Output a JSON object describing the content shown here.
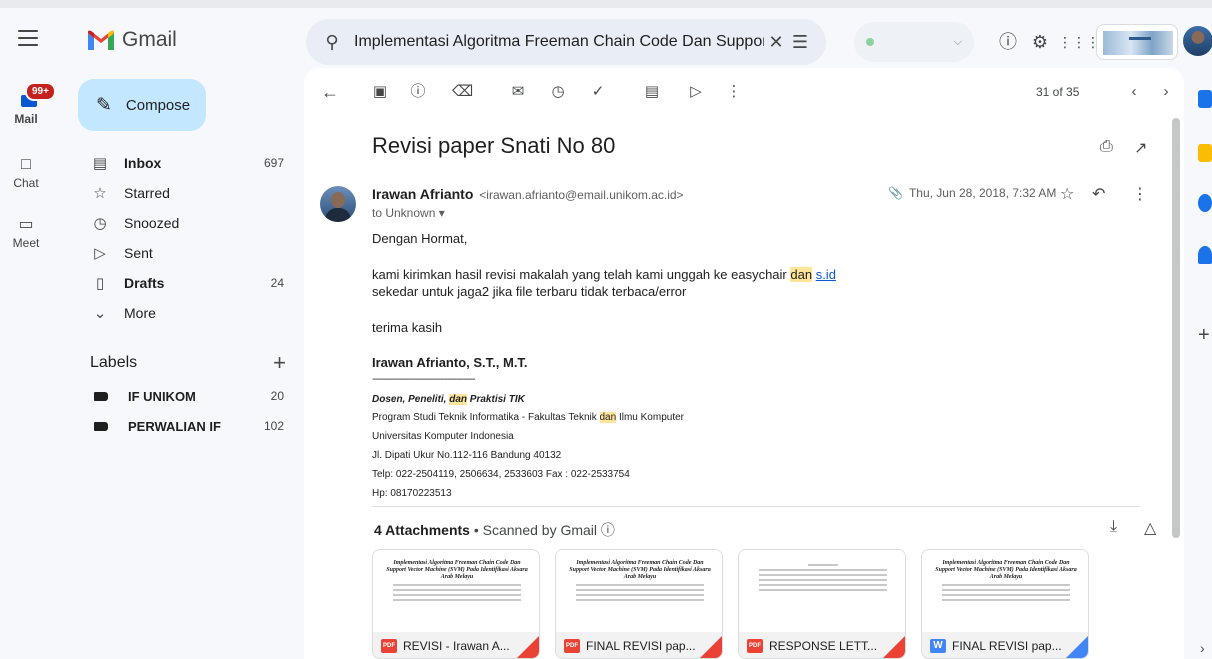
{
  "header": {
    "app_name": "Gmail",
    "search_value": "Implementasi Algoritma Freeman Chain Code Dan Support"
  },
  "rail": {
    "mail_badge": "99+",
    "items": [
      {
        "label": "Mail"
      },
      {
        "label": "Chat"
      },
      {
        "label": "Meet"
      }
    ]
  },
  "sidebar": {
    "compose_label": "Compose",
    "nav": [
      {
        "label": "Inbox",
        "count": "697",
        "icon": "inbox-icon",
        "bold": true
      },
      {
        "label": "Starred",
        "count": "",
        "icon": "star-icon",
        "bold": false
      },
      {
        "label": "Snoozed",
        "count": "",
        "icon": "clock-icon",
        "bold": false
      },
      {
        "label": "Sent",
        "count": "",
        "icon": "send-icon",
        "bold": false
      },
      {
        "label": "Drafts",
        "count": "24",
        "icon": "draft-icon",
        "bold": true
      },
      {
        "label": "More",
        "count": "",
        "icon": "chevron-down-icon",
        "bold": false
      }
    ],
    "labels_title": "Labels",
    "labels": [
      {
        "label": "IF UNIKOM",
        "count": "20"
      },
      {
        "label": "PERWALIAN IF",
        "count": "102"
      }
    ]
  },
  "toolbar": {
    "pager": "31 of 35"
  },
  "message": {
    "subject": "Revisi paper Snati No 80",
    "sender_name": "Irawan Afrianto",
    "sender_email": "<irawan.afrianto@email.unikom.ac.id>",
    "to": "to Unknown",
    "date": "Thu, Jun 28, 2018, 7:32 AM",
    "greeting": "Dengan Hormat,",
    "line1_pre": "kami kirimkan hasil revisi makalah yang telah kami unggah ke easychair ",
    "line1_hl": "dan",
    "line1_link": "s.id",
    "line2": "sekedar untuk jaga2 jika file terbaru tidak terbaca/error",
    "thanks": "terima kasih",
    "sig_name": "Irawan Afrianto, S.T., M.T.",
    "sig_rule": "--------------------------------------------",
    "sig_role_pre": "Dosen, Peneliti, ",
    "sig_role_hl": "dan",
    "sig_role_post": " Praktisi TIK",
    "sig_prog_pre": "Program Studi Teknik Informatika - Fakultas Teknik ",
    "sig_prog_hl": "dan",
    "sig_prog_post": " Ilmu Komputer",
    "sig_univ": "Universitas Komputer Indonesia",
    "sig_addr": "Jl. Dipati Ukur No.112-116 Bandung 40132",
    "sig_telp": "Telp: 022-2504119, 2506634, 2533603 Fax : 022-2533754",
    "sig_hp": "Hp: 08170223513"
  },
  "attachments": {
    "count_label": "4 Attachments",
    "scanned": " •  Scanned by Gmail",
    "items": [
      {
        "name": "REVISI - Irawan A...",
        "type": "PDF",
        "preview": "Implementasi Algoritma Freeman Chain Code Dan Support Vector Machine (SVM) Pada Identifikasi Aksara Arab Melayu"
      },
      {
        "name": "FINAL REVISI pap...",
        "type": "PDF",
        "preview": "Implementasi Algoritma Freeman Chain Code Dan Support Vector Machine (SVM) Pada Identifikasi Aksara Arab Melayu"
      },
      {
        "name": "RESPONSE LETT...",
        "type": "PDF",
        "preview": ""
      },
      {
        "name": "FINAL REVISI pap...",
        "type": "W",
        "preview": "Implementasi Algoritma Freeman Chain Code Dan Support Vector Machine (SVM) Pada Identifikasi Aksara Arab Melayu"
      }
    ]
  },
  "colors": {
    "accent": "#0b57d0",
    "compose_bg": "#c2e7ff",
    "highlight": "#ffe59a",
    "badge": "#c5221f"
  }
}
